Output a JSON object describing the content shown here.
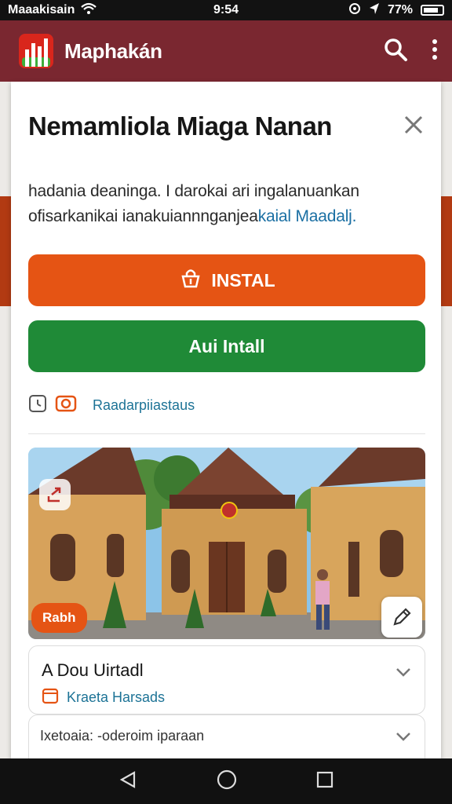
{
  "status_bar": {
    "carrier": "Maaakisain",
    "time": "9:54",
    "battery": "77%"
  },
  "app_bar": {
    "title": "Maphakán",
    "icons": [
      "search-icon",
      "more-vert-icon"
    ]
  },
  "dialog": {
    "title": "Nemamliola Miaga Nanan",
    "description_line1": "hadania deaninga. I darokai ari ingalanuankan",
    "description_line2_prefix": "ofisarkanikai ianakuiannnganjea",
    "description_line2_link": "kaial Maadalj.",
    "install_label": "INSTAL",
    "quick_install_label": "Aui Intall",
    "meta_link": "Raadarpiiastaus"
  },
  "photo": {
    "badge": "Rabh"
  },
  "list": {
    "item1_title": "A Dou Uirtadl",
    "item1_sub": "Kraeta Harsads",
    "item2_title": "Ixetoaia: -oderoim iparaan"
  },
  "colors": {
    "app_bar": "#7a2730",
    "install": "#e55414",
    "quick_install": "#1f8a37",
    "link": "#1d7396"
  }
}
